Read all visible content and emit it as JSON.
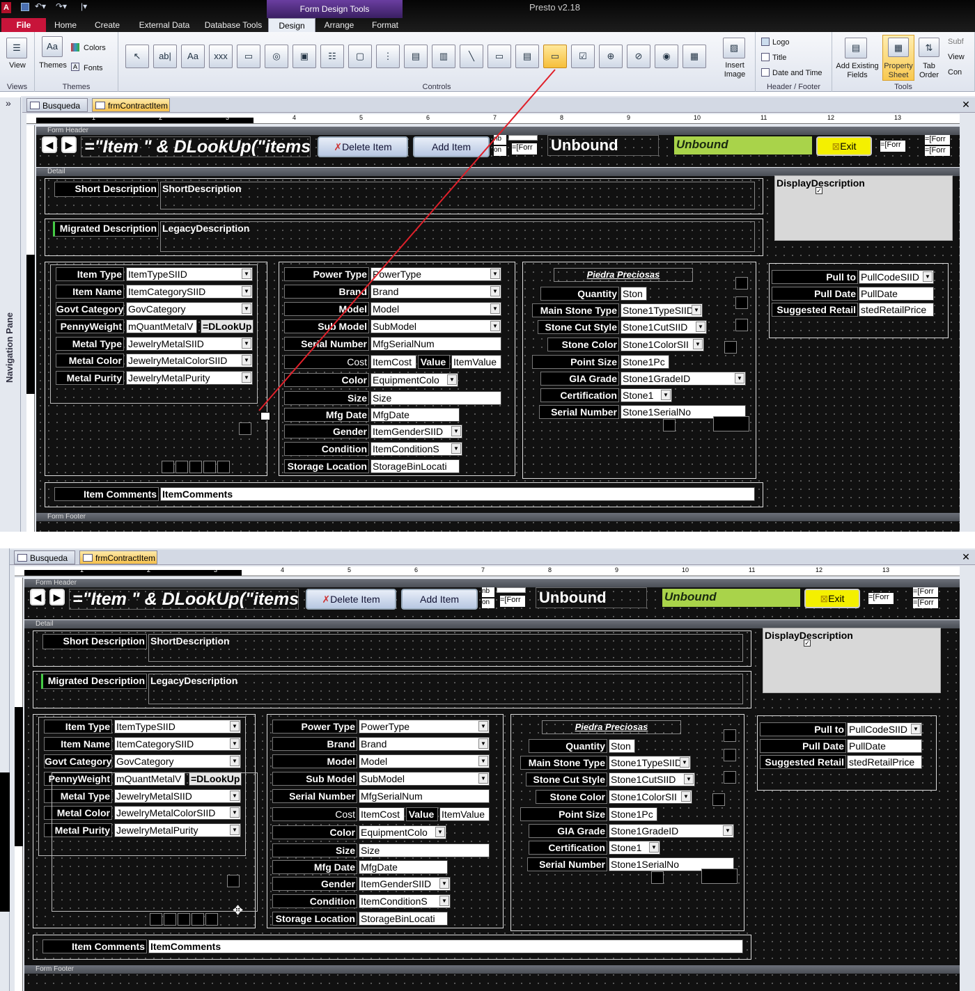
{
  "app": {
    "title": "Presto v2.18",
    "contextual_group": "Form Design Tools"
  },
  "ribbon": {
    "tabs": [
      "File",
      "Home",
      "Create",
      "External Data",
      "Database Tools",
      "Design",
      "Arrange",
      "Format"
    ],
    "active_tab": "Design",
    "groups": {
      "views": "Views",
      "themes": "Themes",
      "controls": "Controls",
      "header_footer": "Header / Footer",
      "tools": "Tools"
    },
    "view_label": "View",
    "themes_label": "Themes",
    "colors_label": "Colors",
    "fonts_label": "Fonts",
    "logo_label": "Logo",
    "title_label": "Title",
    "date_time_label": "Date and Time",
    "insert_image_label1": "Insert",
    "insert_image_label2": "Image",
    "add_existing_fields1": "Add Existing",
    "add_existing_fields2": "Fields",
    "property_sheet1": "Property",
    "property_sheet2": "Sheet",
    "tab_order1": "Tab",
    "tab_order2": "Order",
    "subform_label": "Subf",
    "view_code_label": "View",
    "convert_label": "Con",
    "control_icons": [
      "pointer-icon",
      "textbox-icon",
      "label-icon",
      "button-icon",
      "tab-control-icon",
      "hyperlink-icon",
      "web-browser-icon",
      "navigation-control-icon",
      "option-group-icon",
      "page-break-icon",
      "combo-box-icon",
      "chart-icon",
      "line-icon",
      "toggle-button-icon",
      "list-box-icon",
      "rectangle-icon",
      "checkbox-icon",
      "unbound-object-frame-icon",
      "attachment-icon",
      "option-button-icon",
      "subform-icon"
    ]
  },
  "nav_pane": {
    "label": "Navigation Pane",
    "toggle": "»"
  },
  "doc_tabs": [
    {
      "label": "Busqueda"
    },
    {
      "label": "frmContractItem"
    }
  ],
  "ruler": {
    "numbers": [
      "1",
      "2",
      "3",
      "4",
      "5",
      "6",
      "7",
      "8",
      "9",
      "10",
      "11",
      "12",
      "13"
    ]
  },
  "sections": {
    "header": "Form Header",
    "detail": "Detail",
    "footer": "Form Footer"
  },
  "header_controls": {
    "title_expr": "=\"Item \" & DLookUp(\"itemse",
    "delete_item": "Delete Item",
    "add_item": "Add Item",
    "small1": "nb",
    "small2": "on",
    "small_form": "=[Forr",
    "unbound_label": "Unbound",
    "unbound_green": "Unbound",
    "exit": "Exit",
    "form_ref1": "=[Forr",
    "form_ref2": "=[Forr",
    "form_ref3": "=[Forr"
  },
  "detail": {
    "short_label": "Short Description",
    "short_field": "ShortDescription",
    "migrated_label": "Migrated Description",
    "legacy_field": "LegacyDescription",
    "display_desc": "DisplayDescription",
    "left_labels": [
      "Item Type",
      "Item Name",
      "Govt Category",
      "PennyWeight",
      "Metal Type",
      "Metal Color",
      "Metal Purity"
    ],
    "left_fields": [
      "ItemTypeSIID",
      "ItemCategorySIID",
      "GovCategory",
      "mQuantMetalV",
      "JewelryMetalSIID",
      "JewelryMetalColorSIID",
      "JewelryMetalPurity"
    ],
    "dlookup_field": "=DLookUp",
    "mid_labels": [
      "Power Type",
      "Brand",
      "Model",
      "Sub Model",
      "Serial Number",
      "Cost",
      "Color",
      "Size",
      "Mfg Date",
      "Gender",
      "Condition",
      "Storage Location"
    ],
    "mid_fields": [
      "PowerType",
      "Brand",
      "Model",
      "SubModel",
      "MfgSerialNum",
      "ItemCost",
      "EquipmentColo",
      "Size",
      "MfgDate",
      "ItemGenderSIID",
      "ItemConditionS",
      "StorageBinLocati"
    ],
    "value_label": "Value",
    "item_value": "ItemValue",
    "stone_title": "Piedra Preciosas",
    "stone_labels": [
      "Quantity",
      "Main Stone Type",
      "Stone Cut Style",
      "Stone Color",
      "Point Size",
      "GIA Grade",
      "Certification",
      "Serial Number"
    ],
    "stone_fields": [
      "Ston",
      "Stone1TypeSIID",
      "Stone1CutSIID",
      "Stone1ColorSII",
      "Stone1Pc",
      "Stone1GradeID",
      "Stone1",
      "Stone1SerialNo"
    ],
    "right_labels": [
      "Pull to",
      "Pull Date",
      "Suggested Retail"
    ],
    "right_fields": [
      "PullCodeSIID",
      "PullDate",
      "stedRetailPrice"
    ],
    "comments_label": "Item Comments",
    "comments_field": "ItemComments"
  },
  "colors": {
    "unbound_green": "#a9d34a",
    "exit_yellow": "#f4f000",
    "drag_line": "#e0202a",
    "file_tab": "#c8143a"
  }
}
